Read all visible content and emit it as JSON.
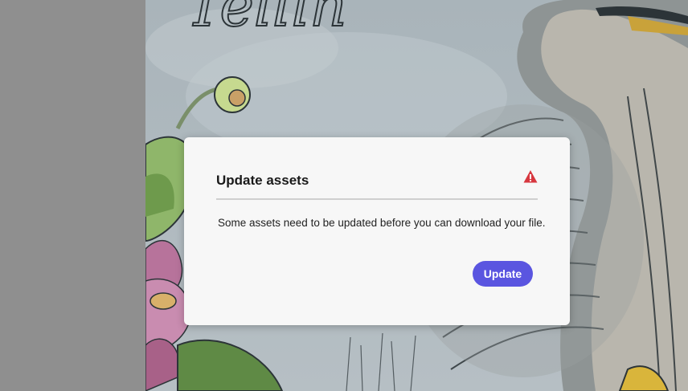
{
  "background": {
    "artwork_script_text": "Tellin",
    "left_panel_color": "#8f8f8f"
  },
  "dialog": {
    "title": "Update assets",
    "message": "Some assets need to be updated before you can download your file.",
    "primary_button_label": "Update",
    "warning_icon": "warning-triangle-icon",
    "colors": {
      "accent": "#5a55e0",
      "warning": "#d7373f",
      "surface": "#f7f7f7"
    }
  }
}
